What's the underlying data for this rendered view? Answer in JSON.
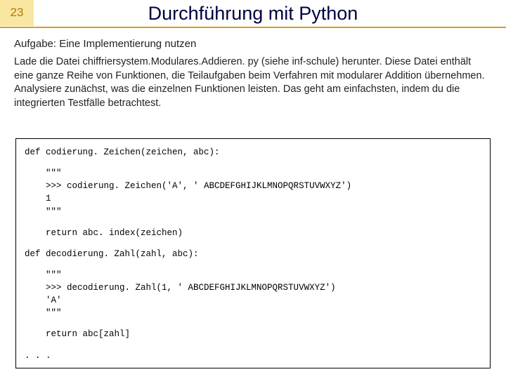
{
  "slide_number": "23",
  "title": "Durchführung mit Python",
  "task_heading": "Aufgabe: Eine Implementierung nutzen",
  "body": "Lade die Datei chiffriersystem.Modulares.Addieren. py (siehe inf-schule) herunter. Diese Datei enthält eine ganze Reihe von Funktionen, die Teilaufgaben beim Verfahren mit modularer Addition übernehmen. Analysiere zunächst, was die einzelnen Funktionen leisten. Das geht am einfachsten, indem du die integrierten Testfälle betrachtest.",
  "code": {
    "l01": "def codierung. Zeichen(zeichen, abc):",
    "l02": "    \"\"\"",
    "l03": "    >>> codierung. Zeichen('A', ' ABCDEFGHIJKLMNOPQRSTUVWXYZ')",
    "l04": "    1",
    "l05": "    \"\"\"",
    "l06": "    return abc. index(zeichen)",
    "l07": "def decodierung. Zahl(zahl, abc):",
    "l08": "    \"\"\"",
    "l09": "    >>> decodierung. Zahl(1, ' ABCDEFGHIJKLMNOPQRSTUVWXYZ')",
    "l10": "    'A'",
    "l11": "    \"\"\"",
    "l12": "    return abc[zahl]",
    "l13": ". . ."
  }
}
